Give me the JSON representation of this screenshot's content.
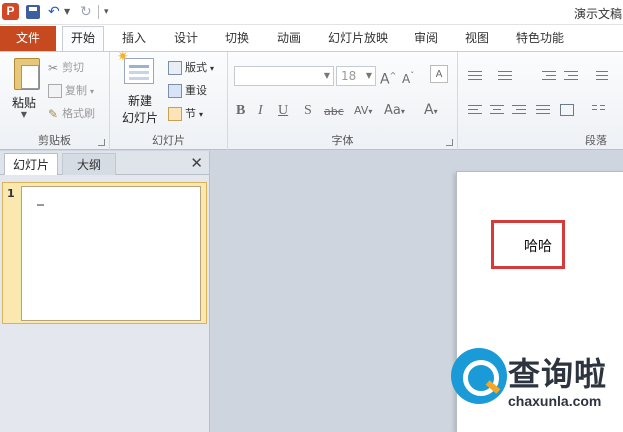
{
  "app": {
    "icon_letter": "P",
    "window_title": "演示文稿"
  },
  "tabs": [
    {
      "label": "文件"
    },
    {
      "label": "开始"
    },
    {
      "label": "插入"
    },
    {
      "label": "设计"
    },
    {
      "label": "切换"
    },
    {
      "label": "动画"
    },
    {
      "label": "幻灯片放映"
    },
    {
      "label": "审阅"
    },
    {
      "label": "视图"
    },
    {
      "label": "特色功能"
    }
  ],
  "ribbon": {
    "clipboard": {
      "label": "剪贴板",
      "paste": "粘贴",
      "cut": "剪切",
      "copy": "复制",
      "format_painter": "格式刷"
    },
    "slides": {
      "label": "幻灯片",
      "new_slide_line1": "新建",
      "new_slide_line2": "幻灯片",
      "layout": "版式",
      "reset": "重设",
      "section": "节"
    },
    "font": {
      "label": "字体",
      "size": "18"
    },
    "paragraph": {
      "label": "段落"
    }
  },
  "left_pane": {
    "tab_slides": "幻灯片",
    "tab_outline": "大纲",
    "slide_number": "1"
  },
  "slide": {
    "text": "哈哈"
  },
  "watermark": {
    "cn": "查询啦",
    "en": "chaxunla.com"
  },
  "colors": {
    "file_tab": "#c6491f",
    "highlight_box": "#d43b3b",
    "selected_thumb": "#fbe7b0"
  }
}
